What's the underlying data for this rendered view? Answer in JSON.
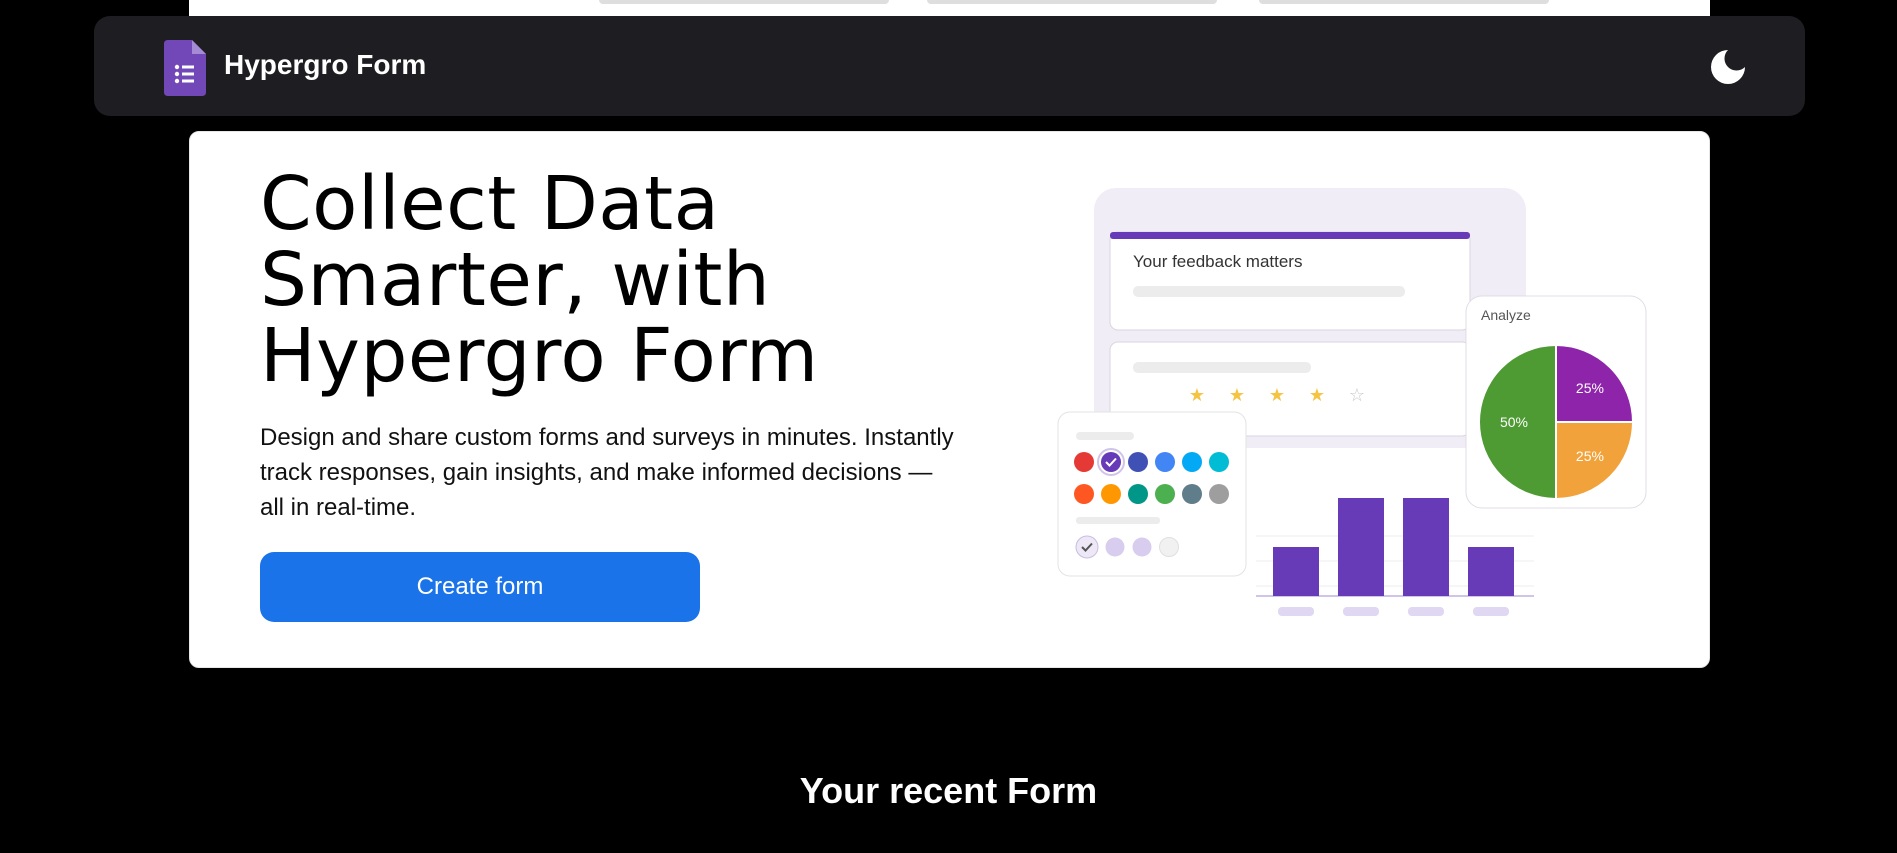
{
  "app": {
    "title": "Hypergro Form"
  },
  "nav": {
    "logo_icon": "forms-logo-icon",
    "theme_toggle_icon": "moon-icon"
  },
  "hero": {
    "title": "Collect Data Smarter, with Hypergro Form",
    "description": "Design and share custom forms and surveys in minutes. Instantly track responses, gain insights, and make informed decisions — all in real-time.",
    "cta_label": "Create form"
  },
  "illustration": {
    "feedback_title": "Your feedback matters",
    "rating": {
      "filled": 4,
      "total": 5
    },
    "analyze_label": "Analyze",
    "pie": [
      {
        "label": "50%",
        "value": 50,
        "color": "#4e9a33"
      },
      {
        "label": "25%",
        "value": 25,
        "color": "#8e24aa"
      },
      {
        "label": "25%",
        "value": 25,
        "color": "#f2a23a"
      }
    ],
    "bars": [
      0.5,
      1.0,
      1.0,
      0.5
    ],
    "palette_row1": [
      "#e53935",
      "#673ab7",
      "#3f51b5",
      "#4285f4",
      "#03a9f4",
      "#00bcd4"
    ],
    "palette_row2": [
      "#ff5722",
      "#ff9800",
      "#009688",
      "#4caf50",
      "#607d8b",
      "#9e9e9e"
    ],
    "accent": "#673ab7"
  },
  "recent": {
    "heading": "Your recent Form"
  },
  "colors": {
    "nav_bg": "#1e1e22",
    "primary_button": "#1a73e8",
    "page_bg": "#000000"
  }
}
